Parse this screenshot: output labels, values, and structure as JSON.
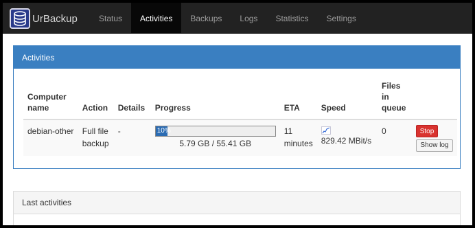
{
  "app": {
    "name": "UrBackup"
  },
  "nav": {
    "items": [
      {
        "label": "Status"
      },
      {
        "label": "Activities"
      },
      {
        "label": "Backups"
      },
      {
        "label": "Logs"
      },
      {
        "label": "Statistics"
      },
      {
        "label": "Settings"
      }
    ],
    "active": "Activities"
  },
  "activities": {
    "title": "Activities",
    "columns": {
      "computer_name": "Computer name",
      "action": "Action",
      "details": "Details",
      "progress": "Progress",
      "eta": "ETA",
      "speed": "Speed",
      "files_in_queue": "Files in queue"
    },
    "rows": [
      {
        "computer_name": "debian-other",
        "action": "Full file backup",
        "details": "-",
        "progress_label": "10%",
        "progress_fraction": 0.1,
        "progress_text": "5.79 GB / 55.41 GB",
        "eta": "11 minutes",
        "speed": "829.42 MBit/s",
        "files_in_queue": "0",
        "stop_label": "Stop",
        "show_log_label": "Show log"
      }
    ]
  },
  "last_activities": {
    "title": "Last activities"
  },
  "colors": {
    "accent": "#3a7fc1",
    "stop": "#d9332f",
    "navbar": "#222222"
  },
  "icons": {
    "logo": "database-icon",
    "speed": "speed-chart-icon"
  }
}
